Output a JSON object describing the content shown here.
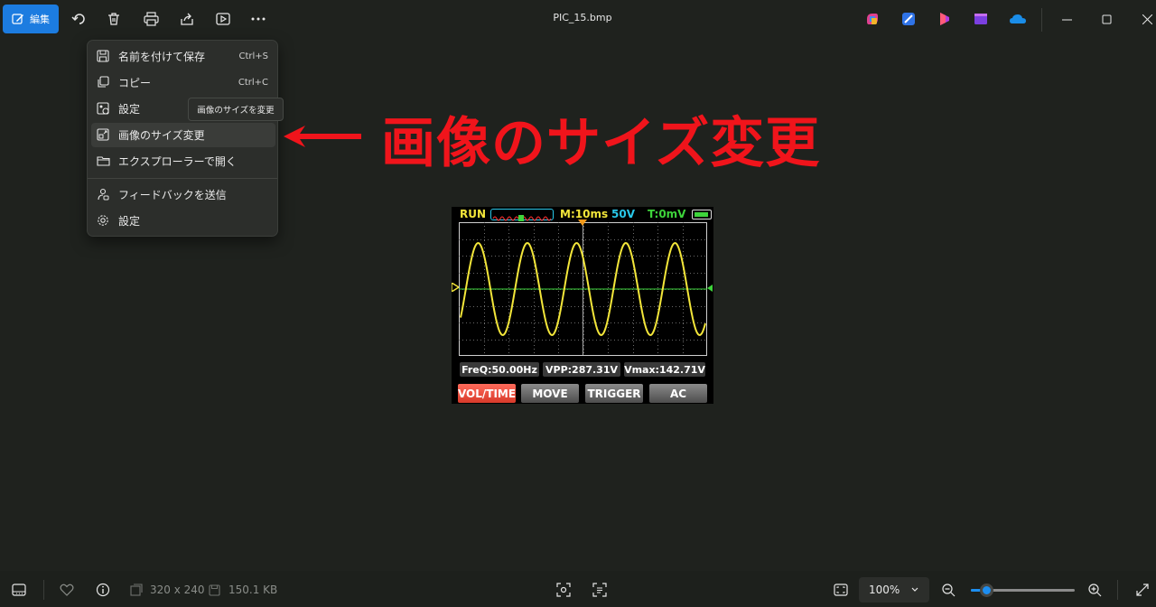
{
  "toolbar": {
    "edit_label": "編集",
    "file_title": "PIC_15.bmp"
  },
  "menu": {
    "items": [
      {
        "label": "名前を付けて保存",
        "shortcut": "Ctrl+S",
        "icon": "save-icon"
      },
      {
        "label": "コピー",
        "shortcut": "Ctrl+C",
        "icon": "copy-icon"
      },
      {
        "label": "設定",
        "shortcut": "",
        "icon": "set-as-icon"
      },
      {
        "label": "画像のサイズ変更",
        "shortcut": "",
        "icon": "resize-icon"
      },
      {
        "label": "エクスプローラーで開く",
        "shortcut": "",
        "icon": "folder-icon"
      },
      {
        "label": "フィードバックを送信",
        "shortcut": "",
        "icon": "feedback-icon"
      },
      {
        "label": "設定",
        "shortcut": "",
        "icon": "gear-icon"
      }
    ],
    "tooltip": "画像のサイズを変更"
  },
  "annotation": {
    "text": "画像のサイズ変更",
    "color": "#f0141b"
  },
  "scope": {
    "run": "RUN",
    "timebase": "M:10ms",
    "volts": "50V",
    "trigger": "T:0mV",
    "measurements": [
      "FreQ:50.00Hz",
      "VPP:287.31V",
      "Vmax:142.71V"
    ],
    "buttons": [
      "VOL/TIME",
      "MOVE",
      "TRIGGER",
      "AC"
    ]
  },
  "bottom": {
    "dimensions": "320 x 240",
    "file_size": "150.1 KB",
    "zoom": "100%",
    "zoom_level_fraction": 0.15
  },
  "colors": {
    "accent": "#1c7ce0",
    "background": "#1f221e"
  }
}
